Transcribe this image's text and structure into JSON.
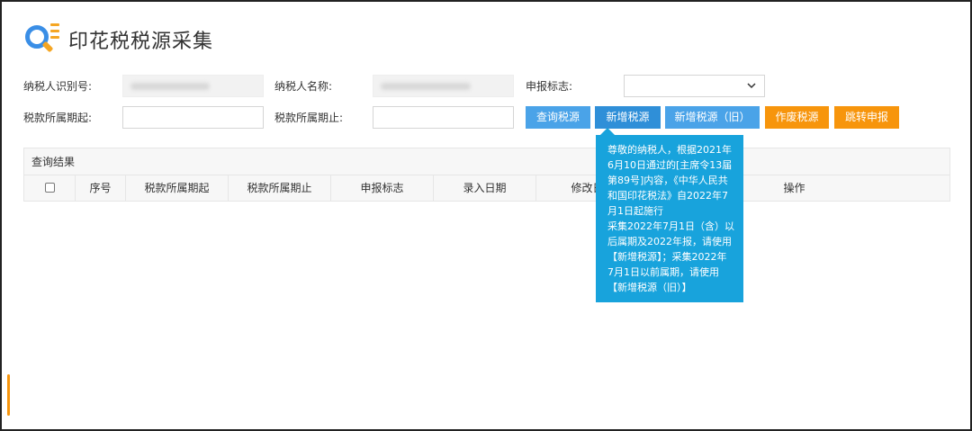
{
  "header": {
    "title": "印花税税源采集"
  },
  "form": {
    "taxpayer_id_label": "纳税人识别号:",
    "taxpayer_name_label": "纳税人名称:",
    "declare_flag_label": "申报标志:",
    "period_start_label": "税款所属期起:",
    "period_end_label": "税款所属期止:",
    "declare_flag_value": "",
    "period_start_value": "",
    "period_end_value": ""
  },
  "buttons": {
    "query": "查询税源",
    "add": "新增税源",
    "add_old": "新增税源（旧）",
    "void": "作废税源",
    "jump": "跳转申报"
  },
  "results": {
    "title": "查询结果",
    "columns": [
      "序号",
      "税款所属期起",
      "税款所属期止",
      "申报标志",
      "录入日期",
      "修改日",
      "操作"
    ]
  },
  "tooltip": {
    "lines": [
      "尊敬的纳税人，根据2021年",
      "6月10日通过的[主席令13届",
      "第89号]内容，《中华人民共",
      "和国印花税法》自2022年7",
      "月1日起施行",
      "采集2022年7月1日（含）以",
      "后属期及2022年报，请使用",
      "【新增税源】；采集2022年",
      "7月1日以前属期，请使用",
      "【新增税源（旧）】"
    ]
  },
  "colors": {
    "primary_blue": "#4aa3e8",
    "accent_orange": "#f7950c",
    "tooltip_blue": "#18a3dc"
  },
  "icons": {
    "logo": "search-magnifier-list-icon",
    "select_arrow": "chevron-down-icon",
    "checkbox": "checkbox-icon"
  }
}
